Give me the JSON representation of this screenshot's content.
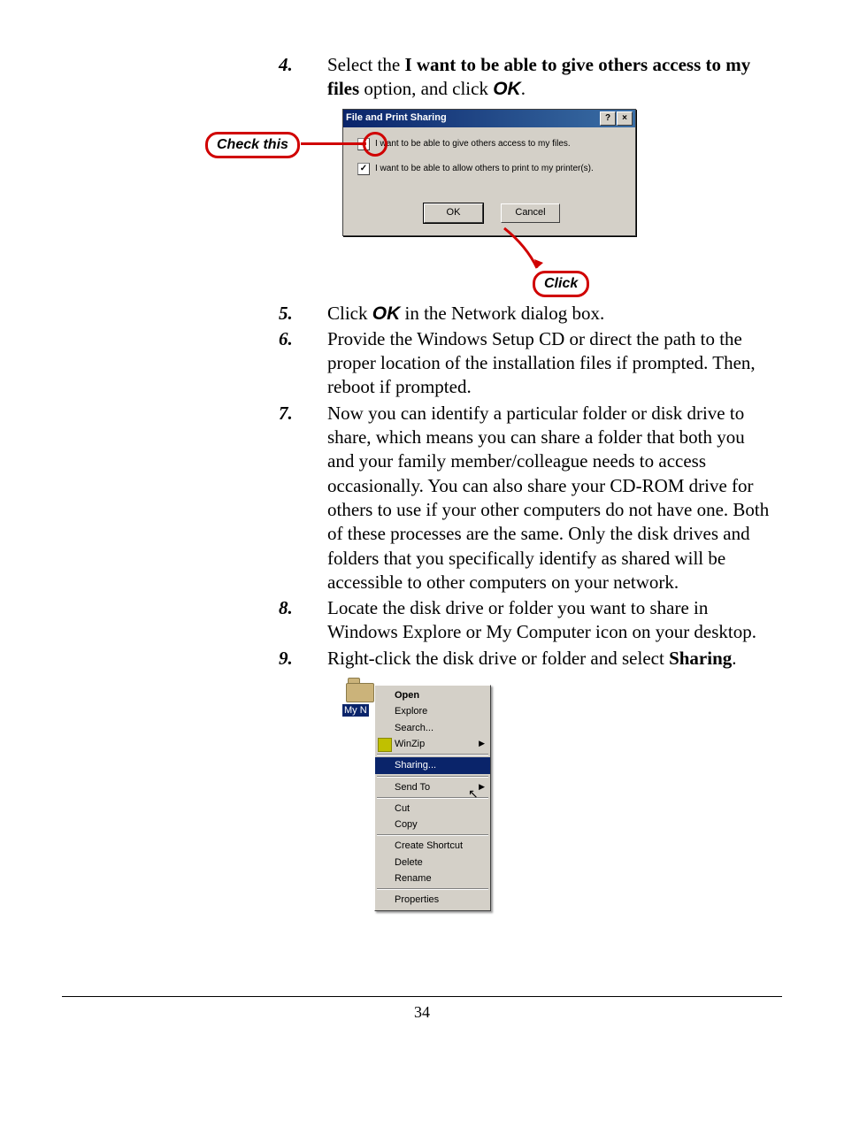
{
  "steps": {
    "s4": {
      "num": "4.",
      "text_a": "Select the ",
      "bold": "I want to be able to give others access to my files",
      "text_b": " option, and click ",
      "ok": "OK",
      "text_c": "."
    },
    "s5": {
      "num": "5.",
      "text_a": "Click ",
      "ok": "OK",
      "text_b": " in the Network dialog box."
    },
    "s6": {
      "num": "6.",
      "text": "Provide the Windows Setup CD or direct the path to the proper location of the installation files if prompted.  Then, reboot if prompted."
    },
    "s7": {
      "num": "7.",
      "text": "Now you can identify a particular folder or disk drive to share, which means you can share a folder that both you and your family member/colleague needs to access occasionally.  You can also share your CD-ROM drive for others to use if your other computers do not have one.  Both of these processes are the same.  Only the disk drives and folders that you specifically identify as shared will be accessible to other computers on your network."
    },
    "s8": {
      "num": "8.",
      "text": "Locate the disk drive or folder you want to share in Windows Explore or My Computer icon on your desktop."
    },
    "s9": {
      "num": "9.",
      "text_a": "Right-click the disk drive or folder and select ",
      "bold": "Sharing",
      "text_b": "."
    }
  },
  "dialog": {
    "title": "File and Print Sharing",
    "help_btn": "?",
    "close_btn": "×",
    "opt1": "I want to be able to give others access to my files.",
    "opt2": "I want to be able to allow others to print to my printer(s).",
    "ok": "OK",
    "cancel": "Cancel"
  },
  "callouts": {
    "check_this": "Check this",
    "click": "Click"
  },
  "contextmenu": {
    "folder_label": "My N",
    "items": {
      "open": "Open",
      "explore": "Explore",
      "search": "Search...",
      "winzip": "WinZip",
      "sharing": "Sharing...",
      "sendto": "Send To",
      "cut": "Cut",
      "copy": "Copy",
      "createshortcut": "Create Shortcut",
      "delete": "Delete",
      "rename": "Rename",
      "properties": "Properties"
    }
  },
  "page_number": "34"
}
